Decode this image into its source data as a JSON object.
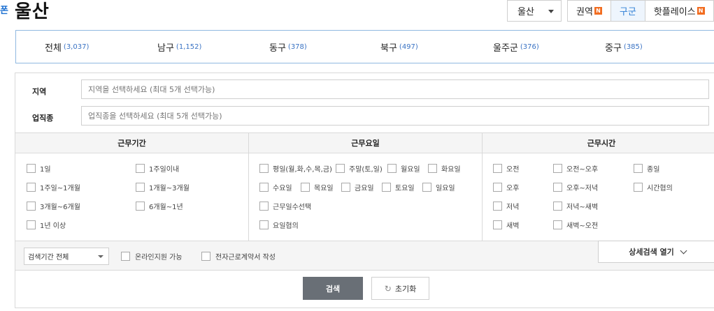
{
  "header": {
    "left_fragment": "폰",
    "title": "울산",
    "city_select": "울산",
    "view_tabs": [
      {
        "label": "권역",
        "badge": "N"
      },
      {
        "label": "구군"
      },
      {
        "label": "핫플레이스",
        "badge": "N"
      }
    ]
  },
  "districts": [
    {
      "name": "전체",
      "count": "(3,037)"
    },
    {
      "name": "남구",
      "count": "(1,152)"
    },
    {
      "name": "동구",
      "count": "(378)"
    },
    {
      "name": "북구",
      "count": "(497)"
    },
    {
      "name": "울주군",
      "count": "(376)"
    },
    {
      "name": "중구",
      "count": "(385)"
    }
  ],
  "filters": {
    "region_label": "지역",
    "region_placeholder": "지역을 선택하세요 (최대 5개 선택가능)",
    "job_label": "업직종",
    "job_placeholder": "업직종을 선택하세요 (최대 5개 선택가능)"
  },
  "conditions": {
    "period": {
      "title": "근무기간",
      "options": [
        "1일",
        "1주일이내",
        "1주일~1개월",
        "1개월~3개월",
        "3개월~6개월",
        "6개월~1년",
        "1년 이상"
      ]
    },
    "days": {
      "title": "근무요일",
      "options": [
        "평일(월,화,수,목,금)",
        "주말(토,일)",
        "월요일",
        "화요일",
        "수요일",
        "목요일",
        "금요일",
        "토요일",
        "일요일",
        "근무일수선택",
        "요일협의"
      ]
    },
    "hours": {
      "title": "근무시간",
      "options": [
        "오전",
        "오전~오후",
        "종일",
        "오후",
        "오후~저녁",
        "시간협의",
        "저녁",
        "저녁~새벽",
        "새벽",
        "새벽~오전"
      ]
    }
  },
  "bottom": {
    "period_select": "검색기간 전체",
    "online_apply": "온라인지원 가능",
    "e_contract": "전자근로계약서 작성",
    "detail_toggle": "상세검색 열기"
  },
  "actions": {
    "search": "검색",
    "reset": "초기화"
  },
  "colors": {
    "accent": "#2f7fd5",
    "badge": "#f26d21",
    "search_button": "#696f76"
  }
}
